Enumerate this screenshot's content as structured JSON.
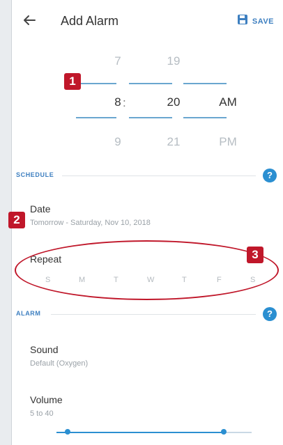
{
  "appbar": {
    "title": "Add Alarm",
    "save_label": "SAVE"
  },
  "time_picker": {
    "hours": [
      "7",
      "8",
      "9"
    ],
    "minutes": [
      "19",
      "20",
      "21"
    ],
    "periods": [
      "AM",
      "PM"
    ],
    "selected": {
      "hour": "8",
      "minute": "20",
      "period": "AM"
    },
    "separator": ":"
  },
  "schedule": {
    "section_title": "SCHEDULE",
    "date_title": "Date",
    "date_value": "Tomorrow - Saturday, Nov 10, 2018",
    "repeat_title": "Repeat",
    "days": [
      "S",
      "M",
      "T",
      "W",
      "T",
      "F",
      "S"
    ]
  },
  "alarm": {
    "section_title": "ALARM",
    "sound_title": "Sound",
    "sound_value": "Default (Oxygen)",
    "volume_title": "Volume",
    "volume_value": "5 to 40",
    "volume_range": {
      "min_fraction": 0.12,
      "max_fraction": 0.88
    }
  },
  "annotations": {
    "badge_1": "1",
    "badge_2": "2",
    "badge_3": "3"
  },
  "colors": {
    "accent": "#2b8fd1",
    "badge": "#c0172a"
  }
}
